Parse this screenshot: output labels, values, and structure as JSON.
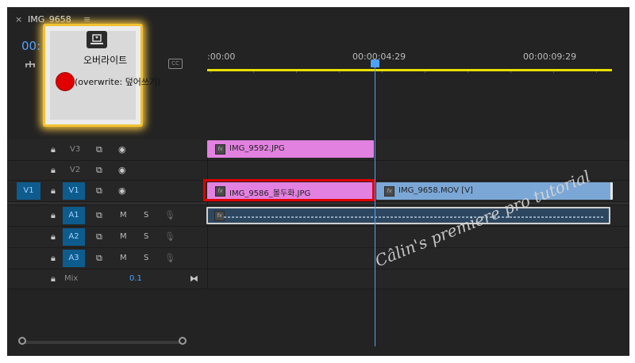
{
  "tab": {
    "close": "×",
    "title": "IMG_9658",
    "menu": "≡"
  },
  "timecode": "00:",
  "ruler": {
    "ticks": [
      ":00:00",
      "00:00:04:29",
      "00:00:09:29"
    ]
  },
  "overlay": {
    "line1": "오버라이트",
    "line2": "(overwrite: 덮어쓰기)"
  },
  "tracks": {
    "video": [
      {
        "label": "V3",
        "target": ""
      },
      {
        "label": "V2",
        "target": ""
      },
      {
        "label": "V1",
        "target": "V1"
      }
    ],
    "audio": [
      {
        "label": "A1",
        "m": "M",
        "s": "S"
      },
      {
        "label": "A2",
        "m": "M",
        "s": "S"
      },
      {
        "label": "A3",
        "m": "M",
        "s": "S"
      }
    ],
    "mix": {
      "label": "Mix",
      "value": "0.1"
    }
  },
  "clips": {
    "v3": "IMG_9592.JPG",
    "v1a": "IMG_9586_볼두화.JPG",
    "v1b": "IMG_9658.MOV [V]"
  },
  "colors": {
    "accent": "#4ea1ff",
    "target": "#0e5c8e",
    "pink_clip": "#e281e0",
    "blue_clip": "#7ba7d6",
    "highlight": "#e00000",
    "workbar": "#e8e000"
  },
  "watermark": "Câlin's premiere pro tutorial"
}
